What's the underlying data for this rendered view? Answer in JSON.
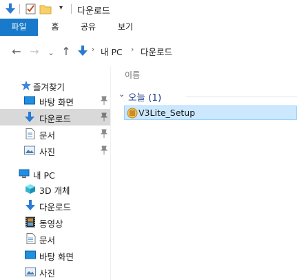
{
  "window": {
    "title": "다운로드"
  },
  "ribbon": {
    "tabs": [
      "파일",
      "홈",
      "공유",
      "보기"
    ]
  },
  "address": {
    "crumbs": [
      "내 PC",
      "다운로드"
    ]
  },
  "quick_access": {
    "label": "즐겨찾기",
    "items": [
      {
        "label": "바탕 화면",
        "icon": "desktop-icon"
      },
      {
        "label": "다운로드",
        "icon": "download-icon"
      },
      {
        "label": "문서",
        "icon": "document-icon"
      },
      {
        "label": "사진",
        "icon": "pictures-icon"
      }
    ]
  },
  "this_pc": {
    "label": "내 PC",
    "items": [
      {
        "label": "3D 개체",
        "icon": "3d-objects-icon"
      },
      {
        "label": "다운로드",
        "icon": "download-icon"
      },
      {
        "label": "동영상",
        "icon": "videos-icon"
      },
      {
        "label": "문서",
        "icon": "document-icon"
      },
      {
        "label": "바탕 화면",
        "icon": "desktop-icon"
      },
      {
        "label": "사진",
        "icon": "pictures-icon"
      }
    ]
  },
  "content": {
    "column_header": "이름",
    "group_label": "오늘 (1)",
    "files": [
      {
        "name": "V3Lite_Setup",
        "icon": "installer-icon"
      }
    ]
  },
  "colors": {
    "accent": "#1979ca",
    "selection": "#cce8ff",
    "nav_selected": "#d9d9d9"
  }
}
